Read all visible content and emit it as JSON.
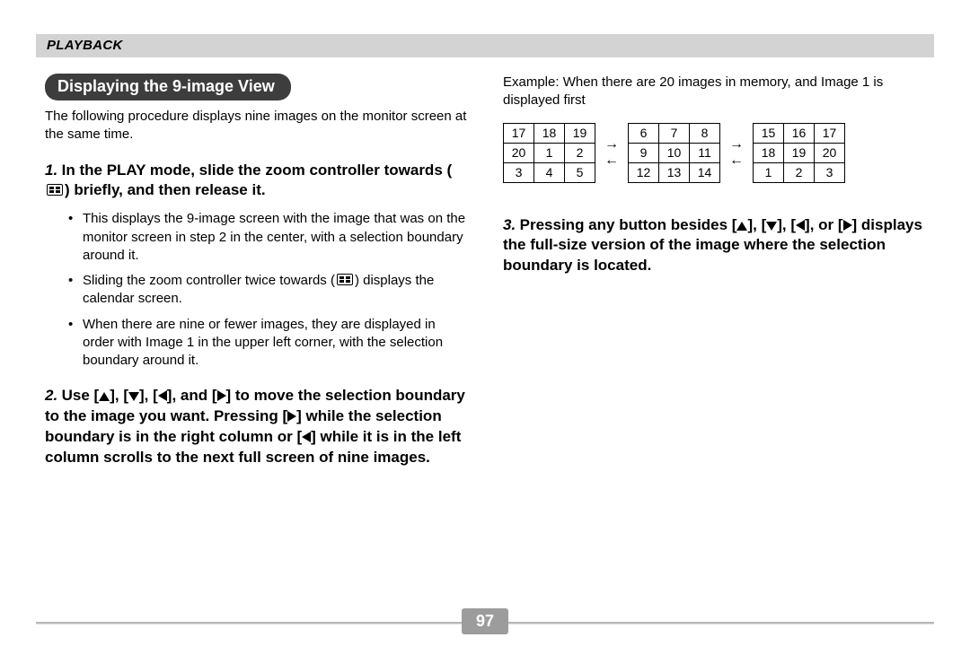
{
  "header": {
    "section": "PLAYBACK"
  },
  "left": {
    "title": "Displaying the 9-image View",
    "intro": "The following procedure displays nine images on the monitor screen at the same time.",
    "step1": {
      "num": "1.",
      "text_a": "In the PLAY mode, slide the zoom controller towards (",
      "text_b": ") briefly, and then release it.",
      "bullets": {
        "b1": "This displays the 9-image screen with the image that was on the monitor screen in step 2 in the center, with a selection boundary around it.",
        "b2_a": "Sliding the zoom controller twice towards (",
        "b2_b": ") displays the calendar screen.",
        "b3": "When there are nine or fewer images, they are displayed in order with Image 1 in the upper left corner, with the selection boundary around it."
      }
    },
    "step2": {
      "num": "2.",
      "p1": "Use [",
      "p2": "], [",
      "p3": "], [",
      "p4": "], and [",
      "p5": "] to move the selection boundary to the image you want. Pressing [",
      "p6": "] while the selection boundary is in the right column or [",
      "p7": "] while it is in the left column scrolls to the next full screen of nine images."
    }
  },
  "right": {
    "example_a": "Example:",
    "example_b": "When there are 20 images in memory, and Image 1 is displayed first",
    "grid_a": [
      [
        "17",
        "18",
        "19"
      ],
      [
        "20",
        "1",
        "2"
      ],
      [
        "3",
        "4",
        "5"
      ]
    ],
    "grid_b": [
      [
        "6",
        "7",
        "8"
      ],
      [
        "9",
        "10",
        "11"
      ],
      [
        "12",
        "13",
        "14"
      ]
    ],
    "grid_c": [
      [
        "15",
        "16",
        "17"
      ],
      [
        "18",
        "19",
        "20"
      ],
      [
        "1",
        "2",
        "3"
      ]
    ],
    "step3": {
      "num": "3.",
      "p1": "Pressing any button besides [",
      "p2": "], [",
      "p3": "], [",
      "p4": "], or [",
      "p5": "] displays the full-size version of the image where the selection boundary is located."
    }
  },
  "footer": {
    "page": "97"
  }
}
